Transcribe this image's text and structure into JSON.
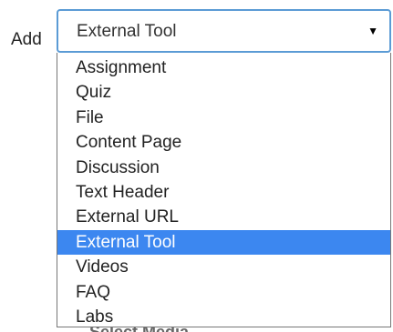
{
  "add_label": "Add",
  "select": {
    "value": "External Tool",
    "arrow": "▼"
  },
  "background_text": "Select Media",
  "dropdown": {
    "options": [
      {
        "label": "Assignment",
        "selected": false
      },
      {
        "label": "Quiz",
        "selected": false
      },
      {
        "label": "File",
        "selected": false
      },
      {
        "label": "Content Page",
        "selected": false
      },
      {
        "label": "Discussion",
        "selected": false
      },
      {
        "label": "Text Header",
        "selected": false
      },
      {
        "label": "External URL",
        "selected": false
      },
      {
        "label": "External Tool",
        "selected": true
      },
      {
        "label": "Videos",
        "selected": false
      },
      {
        "label": "FAQ",
        "selected": false
      },
      {
        "label": "Labs",
        "selected": false
      }
    ]
  },
  "colors": {
    "selected_bg": "#3c87f0",
    "selected_text": "#ffffff",
    "select_border": "#5b9bd5"
  }
}
